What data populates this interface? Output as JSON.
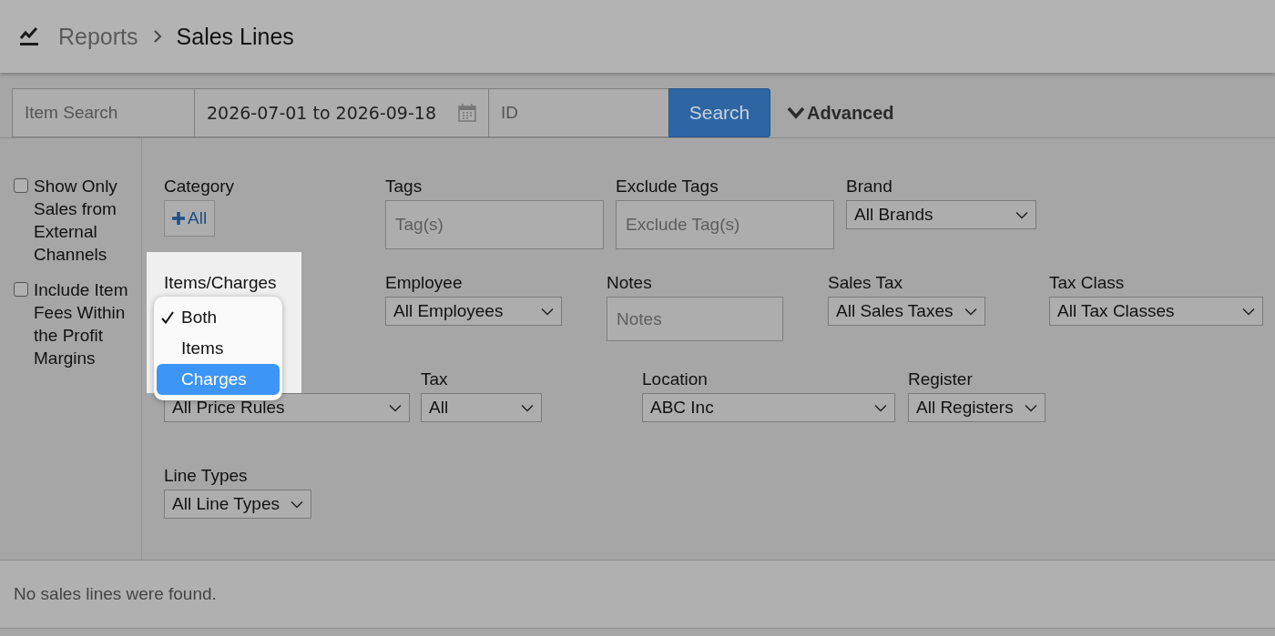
{
  "header": {
    "section": "Reports",
    "page": "Sales Lines"
  },
  "search_bar": {
    "item_search": {
      "placeholder": "Item Search"
    },
    "date_range": {
      "value": "2026-07-01 to 2026-09-18"
    },
    "id_field": {
      "placeholder": "ID"
    },
    "search_button": "Search",
    "advanced_toggle": "Advanced"
  },
  "options": [
    {
      "label": "Show Only Sales from External Channels",
      "checked": false
    },
    {
      "label": "Include Item Fees Within the Profit Margins",
      "checked": false
    }
  ],
  "filter_rows": [
    [
      {
        "kind": "button",
        "label": "Category",
        "button": "All"
      },
      {
        "kind": "text",
        "label": "Tags",
        "placeholder": "Tag(s)"
      },
      {
        "kind": "text",
        "label": "Exclude Tags",
        "placeholder": "Exclude Tag(s)"
      },
      {
        "kind": "select",
        "label": "Brand",
        "value": "All Brands"
      }
    ],
    [
      {
        "kind": "menu",
        "label": "Items/Charges",
        "options": [
          {
            "label": "Both",
            "selected": true,
            "highlighted": false
          },
          {
            "label": "Items",
            "selected": false,
            "highlighted": false
          },
          {
            "label": "Charges",
            "selected": false,
            "highlighted": true
          }
        ]
      },
      {
        "kind": "select",
        "label": "Employee",
        "value": "All Employees"
      },
      {
        "kind": "text",
        "label": "Notes",
        "placeholder": "Notes"
      },
      {
        "kind": "select",
        "label": "Sales Tax",
        "value": "All Sales Taxes"
      },
      {
        "kind": "select",
        "label": "Tax Class",
        "value": "All Tax Classes"
      }
    ],
    [
      {
        "kind": "select",
        "value": "All Price Rules"
      },
      {
        "kind": "select",
        "label": "Tax",
        "value": "All"
      },
      {
        "kind": "select",
        "label": "Location",
        "value": "ABC Inc"
      },
      {
        "kind": "select",
        "label": "Register",
        "value": "All Registers"
      }
    ],
    [
      {
        "kind": "select",
        "label": "Line Types",
        "value": "All Line Types"
      }
    ]
  ],
  "message": "No sales lines were found."
}
